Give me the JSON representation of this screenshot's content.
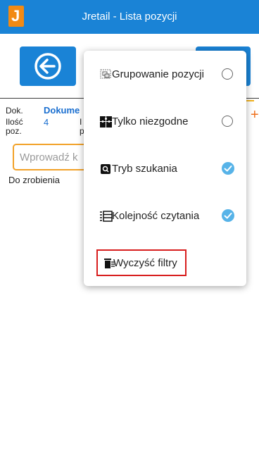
{
  "header": {
    "title": "Jretail - Lista pozycji",
    "logo_letter": "J"
  },
  "nav": {
    "back_icon": "arrow-left-icon"
  },
  "details": {
    "doc_label": "Dok.",
    "doc_value": "Dokume",
    "count_label_line1": "Ilość",
    "count_label_line2": "poz.",
    "count_value": "4",
    "col2_label_line1": "I",
    "col2_label_line2": "p"
  },
  "search": {
    "placeholder": "Wprowadź k"
  },
  "status": {
    "text": "Do zrobienia"
  },
  "menu": {
    "items": [
      {
        "label": "Grupowanie pozycji",
        "icon": "group-icon",
        "checked": false
      },
      {
        "label": "Tylko niezgodne",
        "icon": "puzzle-icon",
        "checked": false
      },
      {
        "label": "Tryb szukania",
        "icon": "search-mode-icon",
        "checked": true
      },
      {
        "label": "Kolejność czytania",
        "icon": "reading-order-icon",
        "checked": true
      }
    ],
    "clear_label": "Wyczyść filtry",
    "clear_icon": "trash-icon"
  },
  "colors": {
    "primary": "#1a83d6",
    "accent_orange": "#f2a229",
    "check_blue": "#57b3e8",
    "highlight_red": "#d81e1e",
    "doc_blue": "#1a6fd0"
  }
}
